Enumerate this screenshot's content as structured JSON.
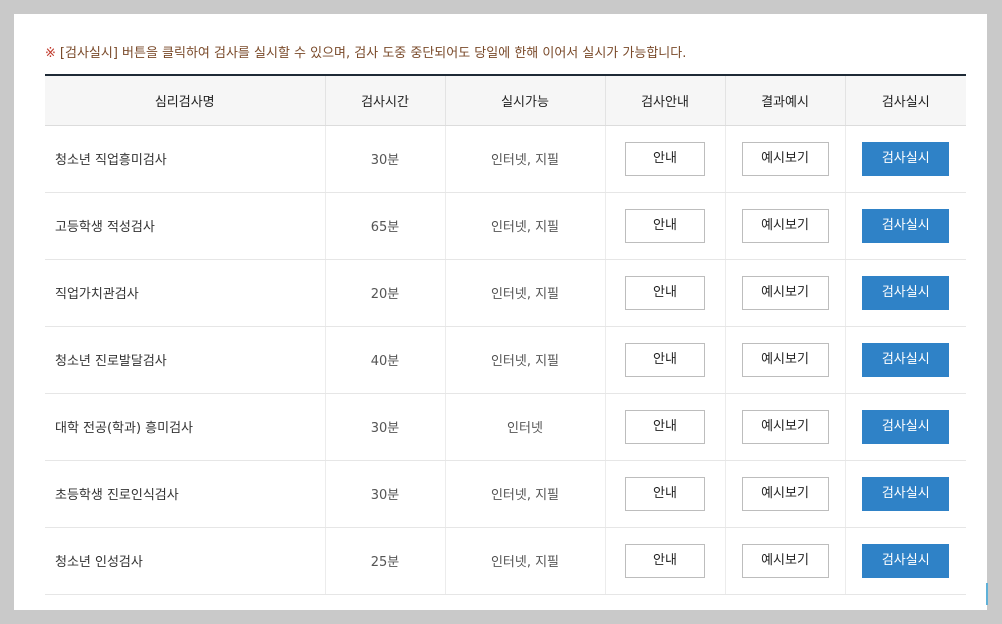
{
  "notice": {
    "mark": "※",
    "text": "[검사실시] 버튼을 클릭하여 검사를 실시할 수 있으며, 검사 도중 중단되어도 당일에 한해 이어서 실시가 가능합니다."
  },
  "table": {
    "headers": [
      "심리검사명",
      "검사시간",
      "실시가능",
      "검사안내",
      "결과예시",
      "검사실시"
    ],
    "rows": [
      {
        "name": "청소년 직업흥미검사",
        "time": "30분",
        "mode": "인터넷, 지필",
        "guide": "안내",
        "example": "예시보기",
        "start": "검사실시"
      },
      {
        "name": "고등학생 적성검사",
        "time": "65분",
        "mode": "인터넷, 지필",
        "guide": "안내",
        "example": "예시보기",
        "start": "검사실시"
      },
      {
        "name": "직업가치관검사",
        "time": "20분",
        "mode": "인터넷, 지필",
        "guide": "안내",
        "example": "예시보기",
        "start": "검사실시"
      },
      {
        "name": "청소년 진로발달검사",
        "time": "40분",
        "mode": "인터넷, 지필",
        "guide": "안내",
        "example": "예시보기",
        "start": "검사실시"
      },
      {
        "name": "대학 전공(학과) 흥미검사",
        "time": "30분",
        "mode": "인터넷",
        "guide": "안내",
        "example": "예시보기",
        "start": "검사실시"
      },
      {
        "name": "초등학생 진로인식검사",
        "time": "30분",
        "mode": "인터넷, 지필",
        "guide": "안내",
        "example": "예시보기",
        "start": "검사실시"
      },
      {
        "name": "청소년 인성검사",
        "time": "25분",
        "mode": "인터넷, 지필",
        "guide": "안내",
        "example": "예시보기",
        "start": "검사실시"
      }
    ]
  },
  "colors": {
    "primary_button": "#2f82c7",
    "notice_text": "#7a4a2a",
    "header_border": "#1e2a36"
  }
}
